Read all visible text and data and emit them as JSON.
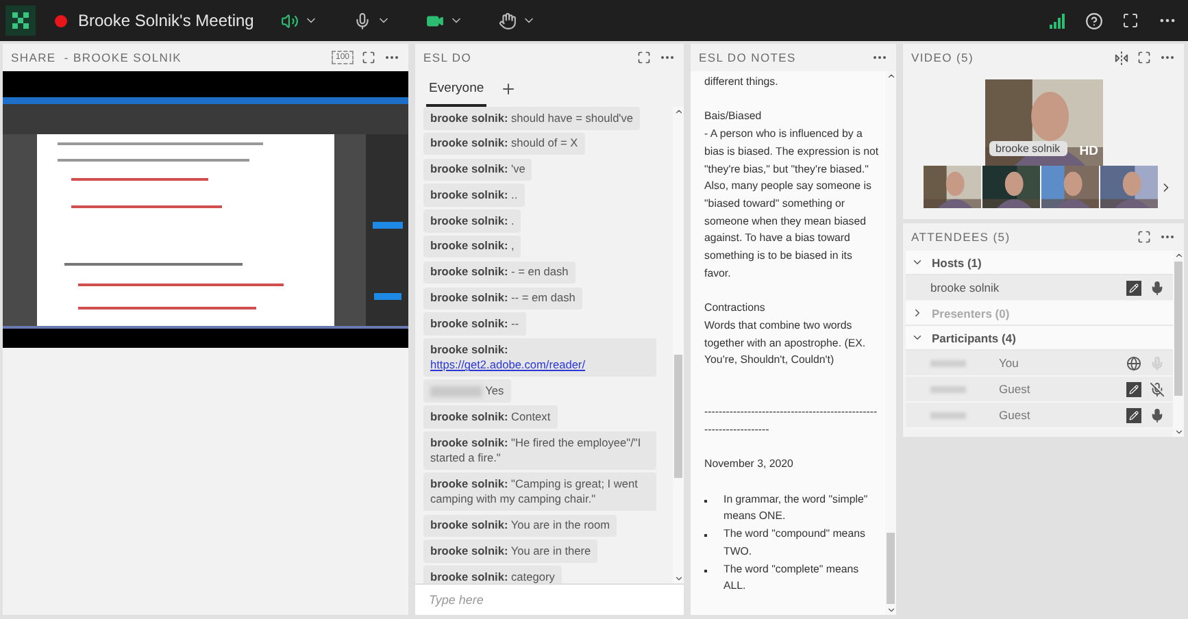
{
  "top_bar": {
    "title": "Brooke Solnik's Meeting",
    "recording": true,
    "controls": [
      {
        "kind": "speaker",
        "on": true
      },
      {
        "kind": "mic",
        "on": false
      },
      {
        "kind": "camera",
        "on": true
      },
      {
        "kind": "hand",
        "on": false
      }
    ]
  },
  "share_pod": {
    "title": "SHARE  - BROOKE SOLNIK",
    "zoom_label": "100"
  },
  "chat_pod": {
    "title": "ESL DO",
    "tabs": [
      {
        "label": "Everyone",
        "selected": true
      }
    ],
    "placeholder": "Type here",
    "messages": [
      {
        "sender": "brooke solnik:",
        "text": "should have = should've"
      },
      {
        "sender": "brooke solnik:",
        "text": "should of  = X"
      },
      {
        "sender": "brooke solnik:",
        "text": "'ve"
      },
      {
        "sender": "brooke solnik:",
        "text": ".."
      },
      {
        "sender": "brooke solnik:",
        "text": "."
      },
      {
        "sender": "brooke solnik:",
        "text": ","
      },
      {
        "sender": "brooke solnik:",
        "text": "- = en dash"
      },
      {
        "sender": "brooke solnik:",
        "text": "-- = em dash"
      },
      {
        "sender": "brooke solnik:",
        "text": "--"
      },
      {
        "sender": "brooke solnik:",
        "text": "https://get2.adobe.com/reader/",
        "kind": "link"
      },
      {
        "sender_hidden": true,
        "text": "Yes"
      },
      {
        "sender": "brooke solnik:",
        "text": "Context"
      },
      {
        "sender": "brooke solnik:",
        "text": "\"He fired the employee\"/\"I started a fire.\""
      },
      {
        "sender": "brooke solnik:",
        "text": "\"Camping is great; I went camping with my camping chair.\""
      },
      {
        "sender": "brooke solnik:",
        "text": "You are in the room"
      },
      {
        "sender": "brooke solnik:",
        "text": "You are in there"
      },
      {
        "sender": "brooke solnik:",
        "text": "category"
      }
    ]
  },
  "notes_pod": {
    "title": "ESL DO NOTES",
    "paragraphs": [
      {
        "kind": "text",
        "text": "different things."
      },
      {
        "kind": "blank"
      },
      {
        "kind": "text",
        "text": "Bais/Biased"
      },
      {
        "kind": "text",
        "text": "- A person who is influenced by a bias is biased. The expression is not \"they're bias,\" but \"they're biased.\" Also, many people say someone is \"biased toward\" something or someone when they mean biased against. To have a bias toward something is to be biased in its favor."
      },
      {
        "kind": "blank"
      },
      {
        "kind": "text",
        "text": "Contractions"
      },
      {
        "kind": "text",
        "text": "Words that combine two words together with an apostrophe. (EX. You're, Shouldn't, Couldn't)"
      },
      {
        "kind": "blank"
      },
      {
        "kind": "blank"
      },
      {
        "kind": "rule",
        "text": "------------------------------------------------------------------"
      },
      {
        "kind": "blank"
      },
      {
        "kind": "text",
        "text": "November 3, 2020"
      },
      {
        "kind": "blank"
      },
      {
        "kind": "bullet",
        "text": "In grammar, the word \"simple\" means ONE."
      },
      {
        "kind": "bullet",
        "text": "The word \"compound\" means TWO."
      },
      {
        "kind": "bullet",
        "text": "The word \"complete\" means ALL."
      }
    ]
  },
  "video_pod": {
    "title": "VIDEO (5)",
    "main": {
      "name": "brooke solnik",
      "quality": "HD"
    }
  },
  "attendees_pod": {
    "title": "ATTENDEES (5)",
    "groups": [
      {
        "label": "Hosts (1)",
        "expanded": true,
        "disabled": false,
        "rows": [
          {
            "name": "brooke solnik",
            "highlighted": true,
            "icons": [
              {
                "kind": "pencil"
              },
              {
                "kind": "mic",
                "muted": false,
                "disabled": false
              }
            ]
          }
        ]
      },
      {
        "label": "Presenters (0)",
        "expanded": false,
        "disabled": true
      },
      {
        "label": "Participants (4)",
        "expanded": true,
        "disabled": false,
        "rows": [
          {
            "name_hidden": true,
            "role": "You",
            "highlighted": true,
            "icons": [
              {
                "kind": "globe"
              },
              {
                "kind": "mic",
                "muted": false,
                "disabled": true
              }
            ]
          },
          {
            "name_hidden": true,
            "role": "Guest",
            "highlighted": true,
            "icons": [
              {
                "kind": "pencil"
              },
              {
                "kind": "mic",
                "muted": true,
                "disabled": false
              }
            ]
          },
          {
            "name_hidden": true,
            "role": "Guest",
            "highlighted": true,
            "icons": [
              {
                "kind": "pencil"
              },
              {
                "kind": "mic",
                "muted": false,
                "disabled": false
              }
            ]
          }
        ]
      }
    ]
  }
}
